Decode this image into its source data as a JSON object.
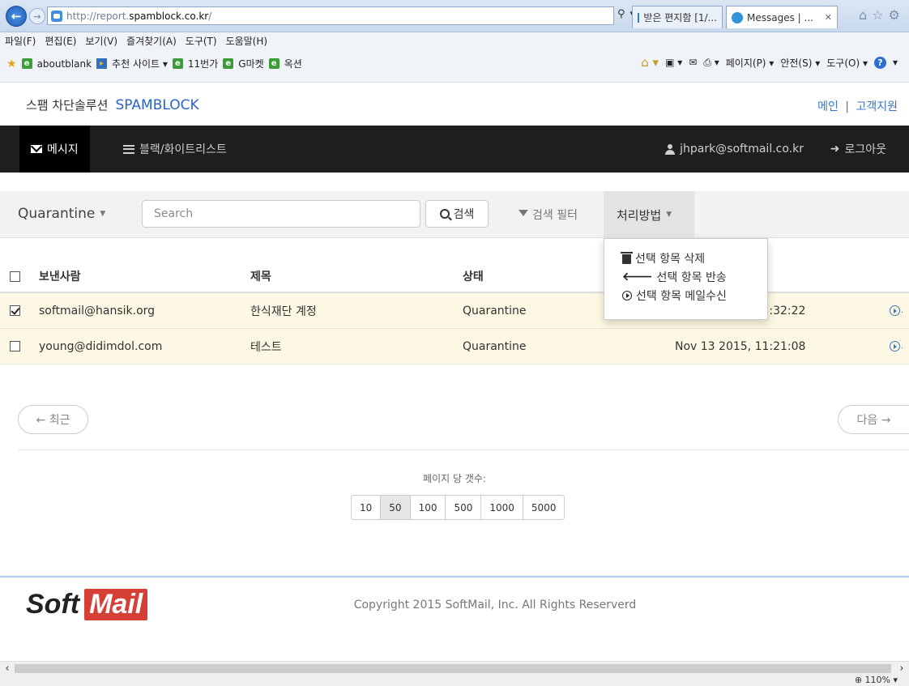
{
  "browser": {
    "address": {
      "scheme": "http://report.",
      "host": "spamblock.co.kr",
      "path": "/"
    },
    "tabs": [
      {
        "label": "받은 편지함 [1/..."
      },
      {
        "label": "Messages | ...",
        "close": "✕"
      }
    ],
    "menu": [
      "파일(F)",
      "편집(E)",
      "보기(V)",
      "즐겨찾기(A)",
      "도구(T)",
      "도움말(H)"
    ],
    "favorites": [
      "aboutblank",
      "추천 사이트 ▾",
      "11번가",
      "G마켓",
      "옥션"
    ],
    "commands": [
      "페이지(P) ▾",
      "안전(S) ▾",
      "도구(O) ▾"
    ],
    "zoom": "⊕ 110%  ▾"
  },
  "header": {
    "brand_ko": "스팸 차단솔루션",
    "brand_en": "SPAMBLOCK",
    "link_main": "메인",
    "link_sep": "|",
    "link_support": "고객지원"
  },
  "nav": {
    "messages": "메시지",
    "blacklist": "블랙/화이트리스트",
    "user": "jhpark@softmail.co.kr",
    "logout": "로그아웃"
  },
  "toolbar": {
    "folder": "Quarantine",
    "search_placeholder": "Search",
    "search_button": "검색",
    "filter": "검색 필터",
    "action": "처리방법"
  },
  "dropdown": {
    "items": [
      "선택 항목 삭제",
      "선택 항목 반송",
      "선택 항목 메일수신"
    ]
  },
  "table": {
    "headers": {
      "sender": "보낸사람",
      "subject": "제목",
      "status": "상태"
    },
    "rows": [
      {
        "checked": true,
        "sender": "softmail@hansik.org",
        "subject": "한식재단 계정",
        "status": "Quarantine",
        "date": "Nov 13 2015, 15:32:22",
        "dot": "."
      },
      {
        "checked": false,
        "sender": "young@didimdol.com",
        "subject": "테스트",
        "status": "Quarantine",
        "date": "Nov 13 2015, 11:21:08",
        "dot": "."
      }
    ]
  },
  "pager": {
    "prev": "← 최근",
    "next": "다음 →",
    "per_page_label": "페이지 당 갯수:",
    "sizes": [
      "10",
      "50",
      "100",
      "500",
      "1000",
      "5000"
    ],
    "active_size": "50"
  },
  "footer": {
    "logo_soft": "Soft",
    "logo_mail": "Mail",
    "copyright": "Copyright 2015 SoftMail, Inc. All Rights Reserverd"
  },
  "colors": {
    "accent": "#2b64c4",
    "navbar": "#1e1e1e",
    "row_highlight": "#fcf8e3",
    "logo_red": "#d53f36"
  }
}
